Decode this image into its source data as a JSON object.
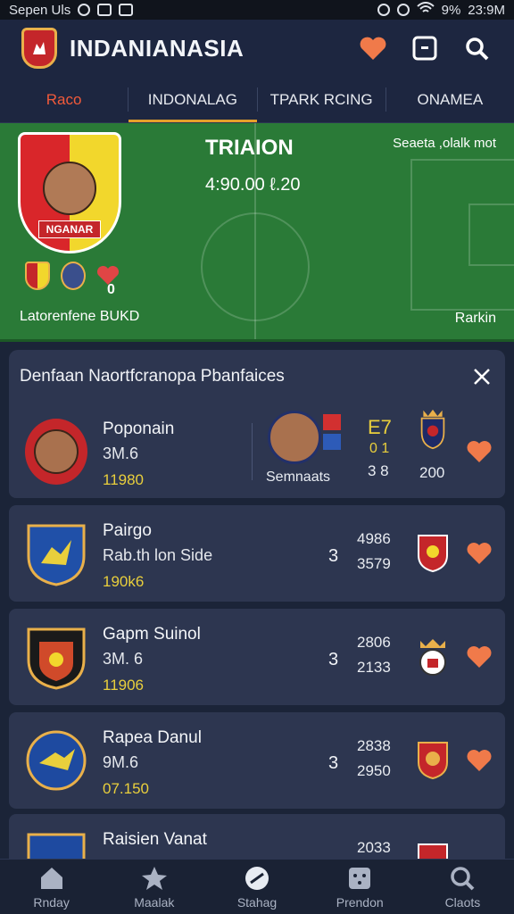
{
  "status_bar": {
    "left_text": "Sepen Uls",
    "battery": "9%",
    "time": "23:9M"
  },
  "header": {
    "title": "INDANIANASIA"
  },
  "tabs": [
    {
      "label": "Raco",
      "active": false
    },
    {
      "label": "INDONALAG",
      "active": true
    },
    {
      "label": "TPARK RCING",
      "active": false
    },
    {
      "label": "ONAMEA",
      "active": false
    }
  ],
  "hero": {
    "player_banner": "NGANAR",
    "title": "TRIAION",
    "score": "4:90.00 ℓ.20",
    "note": "Seaeta ,olalk mot",
    "mini_count": "0",
    "footer_left": "Latorenfene BUKD",
    "footer_right": "Rarkin"
  },
  "panel": {
    "title": "Denfaan Naortfcranopa Pbanfaices",
    "featured": {
      "name": "Poponain",
      "price": "3M.6",
      "value": "11980",
      "player_label": "Semnaats",
      "stat_top": "E7",
      "stat_mid": "0 1",
      "stat_bot": "3 8",
      "club_value": "200"
    },
    "rows": [
      {
        "name": "Pairgo",
        "sub": "Rab.th lon Side",
        "value": "190k6",
        "num": "3",
        "stat1": "4986",
        "stat2": "3579"
      },
      {
        "name": "Gapm Suinol",
        "sub": "3M. 6",
        "value": "11906",
        "num": "3",
        "stat1": "2806",
        "stat2": "2133"
      },
      {
        "name": "Rapea Danul",
        "sub": "9M.6",
        "value": "07.150",
        "num": "3",
        "stat1": "2838",
        "stat2": "2950"
      },
      {
        "name": "Raisien Vanat",
        "sub": "",
        "value": "",
        "num": "",
        "stat1": "2033",
        "stat2": ""
      }
    ]
  },
  "bottom_nav": [
    {
      "label": "Rnday",
      "icon": "home-icon"
    },
    {
      "label": "Maalak",
      "icon": "star-icon"
    },
    {
      "label": "Stahag",
      "icon": "ball-icon"
    },
    {
      "label": "Prendon",
      "icon": "grid-icon"
    },
    {
      "label": "Claots",
      "icon": "search-icon"
    }
  ]
}
